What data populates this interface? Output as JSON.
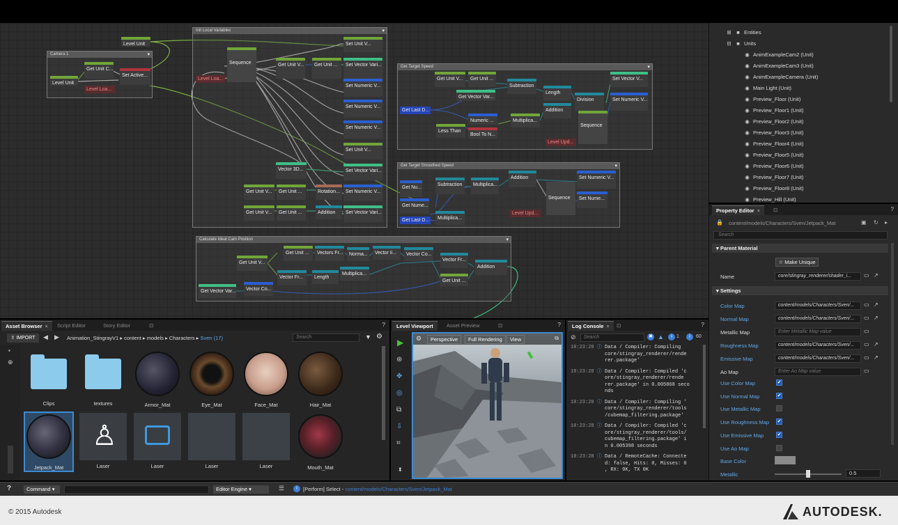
{
  "colors": {
    "accent": "#61a9ec",
    "node_green": "#71a63a",
    "node_blue": "#2b5fd0",
    "node_teal": "#22899b",
    "node_red": "#b1333f"
  },
  "graph": {
    "groups": {
      "exit_local": "Init Local Variables",
      "camera": "Camera 1",
      "target_speed": "Get Target Speed",
      "smoothed": "Get Target Smoothed Speed",
      "ideal": "Calculate Ideal Cam Position"
    },
    "nodes": {
      "level_unit_top": "Level Unit",
      "cam_level_unit": "Level Unit",
      "cam_get_unit": "Get Unit C...",
      "cam_set_active": "Set Active...",
      "cam_level_loa": "Level Loa...",
      "sequence": "Sequence",
      "level_loa2": "Level Loa...",
      "get_unit_v1": "Get Unit V...",
      "get_unit_2": "Get Unit ...",
      "set_unit_v1": "Set Unit V...",
      "set_vector_vari1": "Set Vector Vari...",
      "set_numeric1": "Set Numeric V...",
      "set_numeric2": "Set Numeric V...",
      "set_numeric3": "Set Numeric V...",
      "set_unit_v2": "Set Unit V...",
      "vector3d": "Vector 3D...",
      "set_vector_vari2": "Set Vector Vari...",
      "rotation": "Rotation...",
      "set_numeric4": "Set Numeric V...",
      "addition1": "Addition",
      "set_vector_vari3": "Set Vector Vari...",
      "get_unit_v2": "Get Unit V...",
      "get_unit_3": "Get Unit ...",
      "get_unit_v3": "Get Unit V...",
      "get_unit_4": "Get Unit ...",
      "ts_get_unit_v": "Get Unit V...",
      "ts_get_unit": "Get Unit ...",
      "ts_subtraction": "Subtraction",
      "ts_length": "Length",
      "ts_get_vector_var": "Get Vector Var...",
      "ts_division": "Division",
      "ts_set_vector_v": "Set Vector V...",
      "ts_set_numeric": "Set Numeric V...",
      "ts_get_last_d": "Get Last D...",
      "ts_numeric": "Numeric ...",
      "ts_multiplica": "Multiplica...",
      "ts_addition": "Addition",
      "ts_less_than": "Less Than",
      "ts_bool_to_n": "Bool To N...",
      "ts_sequence": "Sequence",
      "ts_level_upd": "Level Upd...",
      "sm_get_nu": "Get Nu...",
      "sm_subtraction": "Subtraction",
      "sm_multiplica": "Multiplica...",
      "sm_addition": "Addition",
      "sm_set_numeric": "Set Numeric V...",
      "sm_get_nume": "Get Nume...",
      "sm_sequence": "Sequence",
      "sm_set_nume": "Set Nume...",
      "sm_multiplica2": "Multiplica...",
      "sm_get_last_d": "Get Last D...",
      "sm_level_upd": "Level Upd...",
      "ic_get_unit": "Get Unit ...",
      "ic_vectors_fr": "Vectors Fr...",
      "ic_norma": "Norma...",
      "ic_vector_ii": "Vector Ii...",
      "ic_vector_co": "Vector Co...",
      "ic_get_unit_v": "Get Unit V...",
      "ic_vector_fr": "Vector Fr...",
      "ic_length": "Length",
      "ic_multiplica": "Multiplica...",
      "ic_vector_fr2": "Vector Fr...",
      "ic_addition": "Addition",
      "ic_get_unit2": "Get Unit ...",
      "ic_get_vector_var": "Get Vector Var...",
      "ic_vector_co2": "Vector Co..."
    }
  },
  "tree": {
    "entities": "Entities",
    "units": "Units",
    "items": [
      "AnimExampleCam2 (Unit)",
      "AnimExampleCam3 (Unit)",
      "AnimExampleCamera (Unit)",
      "Main Light (Unit)",
      "Preview_Floor (Unit)",
      "Preview_Floor1 (Unit)",
      "Preview_Floor2 (Unit)",
      "Preview_Floor3 (Unit)",
      "Preview_Floor4 (Unit)",
      "Preview_Floor5 (Unit)",
      "Preview_Floor6 (Unit)",
      "Preview_Floor7 (Unit)",
      "Preview_Floor8 (Unit)",
      "Preview_Hill (Unit)"
    ]
  },
  "property_editor": {
    "tab": "Property Editor",
    "path": "content/models/Characters/Sven/Jetpack_Mat",
    "search_placeholder": "Search",
    "parent_material": "Parent Material",
    "make_unique": "Make Unique",
    "name_label": "Name",
    "name_value": "core/stingray_renderer/shader_i...",
    "settings": "Settings",
    "rows": [
      {
        "label": "Color Map",
        "value": "content/models/Characters/Sven/..."
      },
      {
        "label": "Normal Map",
        "value": "content/models/Characters/Sven/..."
      },
      {
        "label": "Metallic Map",
        "value": "Enter Metallic Map value"
      },
      {
        "label": "Roughness Map",
        "value": "content/models/Characters/Sven/..."
      },
      {
        "label": "Emissive Map",
        "value": "content/models/Characters/Sven/..."
      },
      {
        "label": "Ao Map",
        "value": "Enter Ao Map value"
      }
    ],
    "checks": [
      {
        "label": "Use Color Map",
        "checked": true
      },
      {
        "label": "Use Normal Map",
        "checked": true
      },
      {
        "label": "Use Metallic Map",
        "checked": false
      },
      {
        "label": "Use Roughness Map",
        "checked": true
      },
      {
        "label": "Use Emissive Map",
        "checked": true
      },
      {
        "label": "Use Ao Map",
        "checked": false
      }
    ],
    "base_color": "Base Color",
    "metallic": "Metallic",
    "metallic_value": "0.5"
  },
  "asset_browser": {
    "tabs": [
      "Asset Browser",
      "Script Editor",
      "Story Editor"
    ],
    "import": "IMPORT",
    "path": [
      "Animation_StingrayV1",
      "content",
      "models",
      "Characters"
    ],
    "path_current": "Sven (17)",
    "search_placeholder": "Search",
    "tiles": [
      "Clips",
      "textures",
      "Armor_Mat",
      "Eye_Mat",
      "Face_Mat",
      "Hair_Mat",
      "Jetpack_Mat",
      "Laser",
      "Laser",
      "Laser",
      "Laser",
      "Mouth_Mat"
    ]
  },
  "viewport": {
    "tabs": [
      "Level Viewport",
      "Asset Preview"
    ],
    "perspective": "Perspective",
    "full_rendering": "Full Rendering",
    "view": "View"
  },
  "log": {
    "tab": "Log Console",
    "search_placeholder": "Search",
    "count": "60",
    "count_i": "1",
    "lines": [
      {
        "t": "10:23:28",
        "text": "Data / Compiler: Compiling\ncore/stingray_renderer/rende\nrer.package'"
      },
      {
        "t": "10:23:28",
        "text": "Data / Compiler: Compiled 'c\nore/stingray_renderer/rende\nrer.package' in 0.005868 seco\nnds"
      },
      {
        "t": "10:23:28",
        "text": "Data / Compiler: Compiling '\ncore/stingray_renderer/tools\n/cubemap_filtering.package'"
      },
      {
        "t": "10:23:28",
        "text": "Data / Compiler: Compiled 'c\nore/stingray_renderer/tools/\ncubemap_filtering.package' i\nn 0.005398 seconds"
      },
      {
        "t": "10:23:28",
        "text": "Data / RemoteCache: Connecte\nd: false, Hits: 0, Misses: 0\n, RX: 0K, TX 0K"
      }
    ]
  },
  "command": {
    "help": "?",
    "command_label": "Command",
    "engine": "Editor Engine",
    "status_prefix": "[Perform] Select -",
    "status_path": "content/models/Characters/Sven/Jetpack_Mat"
  },
  "footer": {
    "copyright": "© 2015 Autodesk",
    "brand": "AUTODESK."
  }
}
